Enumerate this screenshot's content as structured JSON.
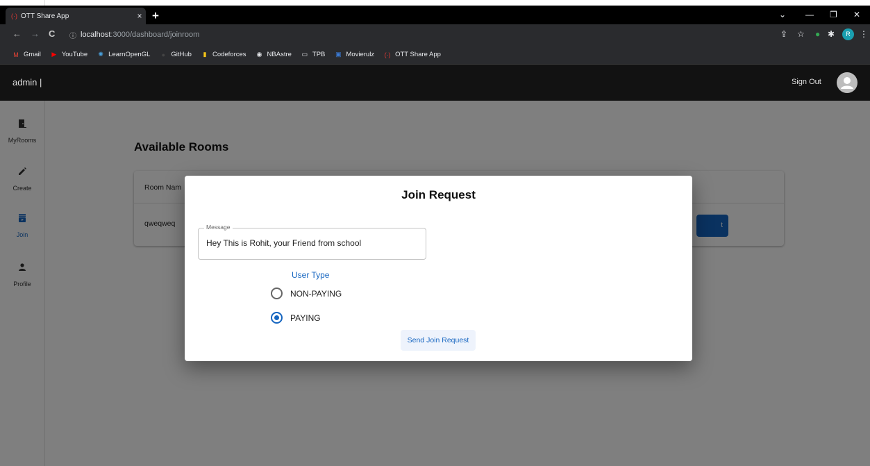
{
  "browser": {
    "tab_title": "OTT Share App",
    "tab_close": "×",
    "new_tab": "+",
    "url_host": "localhost",
    "url_path": ":3000/dashboard/joinroom",
    "profile_initial": "R",
    "bookmarks": [
      {
        "label": "Gmail",
        "icon": "gmail-icon",
        "color": "#ea4335"
      },
      {
        "label": "YouTube",
        "icon": "youtube-icon",
        "color": "#ff0000"
      },
      {
        "label": "LearnOpenGL",
        "icon": "learnopengl-icon",
        "color": "#4aa3df"
      },
      {
        "label": "GitHub",
        "icon": "github-icon",
        "color": "#444444"
      },
      {
        "label": "Codeforces",
        "icon": "codeforces-icon",
        "color": "#f5c518"
      },
      {
        "label": "NBAstre",
        "icon": "globe-icon",
        "color": "#e8eaed"
      },
      {
        "label": "TPB",
        "icon": "tpb-icon",
        "color": "#e8eaed"
      },
      {
        "label": "Movierulz",
        "icon": "movierulz-icon",
        "color": "#3b7bd6"
      },
      {
        "label": "OTT Share App",
        "icon": "ott-icon",
        "color": "#e53935"
      }
    ]
  },
  "app": {
    "brand": "admin |",
    "sign_out": "Sign Out"
  },
  "sidebar": {
    "items": [
      {
        "label": "MyRooms",
        "icon": "door-icon"
      },
      {
        "label": "Create",
        "icon": "pencil-icon"
      },
      {
        "label": "Join",
        "icon": "join-icon"
      },
      {
        "label": "Profile",
        "icon": "person-icon"
      }
    ]
  },
  "main": {
    "title": "Available Rooms",
    "table": {
      "header": "Room Nam",
      "row_value": "qweqweq",
      "join_button": "t"
    }
  },
  "dialog": {
    "title": "Join Request",
    "message_label": "Message",
    "message_value": "Hey This is Rohit, your Friend from school",
    "user_type_label": "User Type",
    "options": [
      {
        "label": "NON-PAYING",
        "checked": false
      },
      {
        "label": "PAYING",
        "checked": true
      }
    ],
    "send_button": "Send Join Request"
  },
  "colors": {
    "accent": "#1565c0",
    "appbar": "#121212",
    "overlay": "rgba(0,0,0,0.5)"
  }
}
